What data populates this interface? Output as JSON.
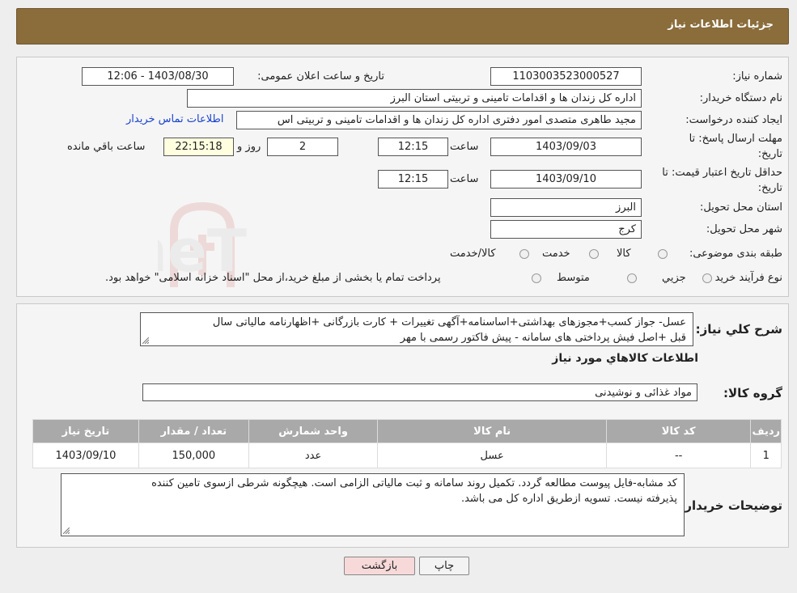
{
  "header": {
    "title": "جزئیات اطلاعات نیاز"
  },
  "need_number": {
    "label": "شماره نیاز:",
    "value": "1103003523000527"
  },
  "announce": {
    "label": "تاریخ و ساعت اعلان عمومی:",
    "value": "1403/08/30 - 12:06"
  },
  "buyer_org": {
    "label": "نام دستگاه خریدار:",
    "value": "اداره کل زندان ها و اقدامات تامینی و تربیتی استان البرز"
  },
  "requester": {
    "label": "ایجاد کننده درخواست:",
    "value": "مجید طاهری متصدی امور دفتری اداره کل زندان ها و اقدامات تامینی و تربیتی اس",
    "contact_link": "اطلاعات تماس خریدار"
  },
  "reply_deadline": {
    "label_line1": "مهلت ارسال پاسخ: تا",
    "label_line2": "تاریخ:",
    "date": "1403/09/03",
    "time_label": "ساعت",
    "time": "12:15",
    "days": "2",
    "days_label": "روز و",
    "remaining": "22:15:18",
    "remaining_label": "ساعت باقي مانده"
  },
  "price_validity": {
    "label_line1": "حداقل تاریخ اعتبار قیمت: تا",
    "label_line2": "تاریخ:",
    "date": "1403/09/10",
    "time_label": "ساعت",
    "time": "12:15"
  },
  "province": {
    "label": "استان محل تحویل:",
    "value": "البرز"
  },
  "city": {
    "label": "شهر محل تحویل:",
    "value": "کرج"
  },
  "category": {
    "label": "طبقه بندی موضوعی:",
    "options": [
      "کالا",
      "خدمت",
      "کالا/خدمت"
    ]
  },
  "purchase_type": {
    "label": "نوع فرآیند خرید :",
    "options": [
      "جزيي",
      "متوسط"
    ],
    "note": "پرداخت تمام یا بخشی از مبلغ خرید،از محل \"اسناد خزانه اسلامی\" خواهد بود."
  },
  "description": {
    "label": "شرح کلي نياز:",
    "line1": "عسل- جواز کسب+مجوزهای بهداشتی+اساسنامه+آگهی تغییرات + کارت بازرگانی +اظهارنامه مالیاتی سال",
    "line2": "قبل +اصل فیش پرداختی های سامانه - پیش فاکتور رسمی با مهر"
  },
  "goods_section": {
    "title": "اطلاعات کالاهاي مورد نياز"
  },
  "goods_group": {
    "label": "گروه کالا:",
    "value": "مواد غذائی و نوشیدنی"
  },
  "table": {
    "headers": [
      "ردیف",
      "کد کالا",
      "نام کالا",
      "واحد شمارش",
      "تعداد / مقدار",
      "تاریخ نیاز"
    ],
    "rows": [
      [
        "1",
        "--",
        "عسل",
        "عدد",
        "150,000",
        "1403/09/10"
      ]
    ]
  },
  "buyer_notes": {
    "label": "توضیحات خریدار:",
    "line1": "کد مشابه-فایل پیوست مطالعه گردد. تکمیل روند سامانه و ثبت مالیاتی الزامی است. هیچگونه شرطی ازسوی تامین کننده",
    "line2": "پذیرفته نیست. تسویه ازطریق اداره کل می باشد."
  },
  "buttons": {
    "print": "چاپ",
    "back": "بازگشت"
  },
  "watermark_text": "AriaTender.neT",
  "colors": {
    "header_bg": "#8a6d3b",
    "link": "#1a44cc",
    "table_header": "#a9a9a9",
    "back_button": "#f7d9d9"
  }
}
